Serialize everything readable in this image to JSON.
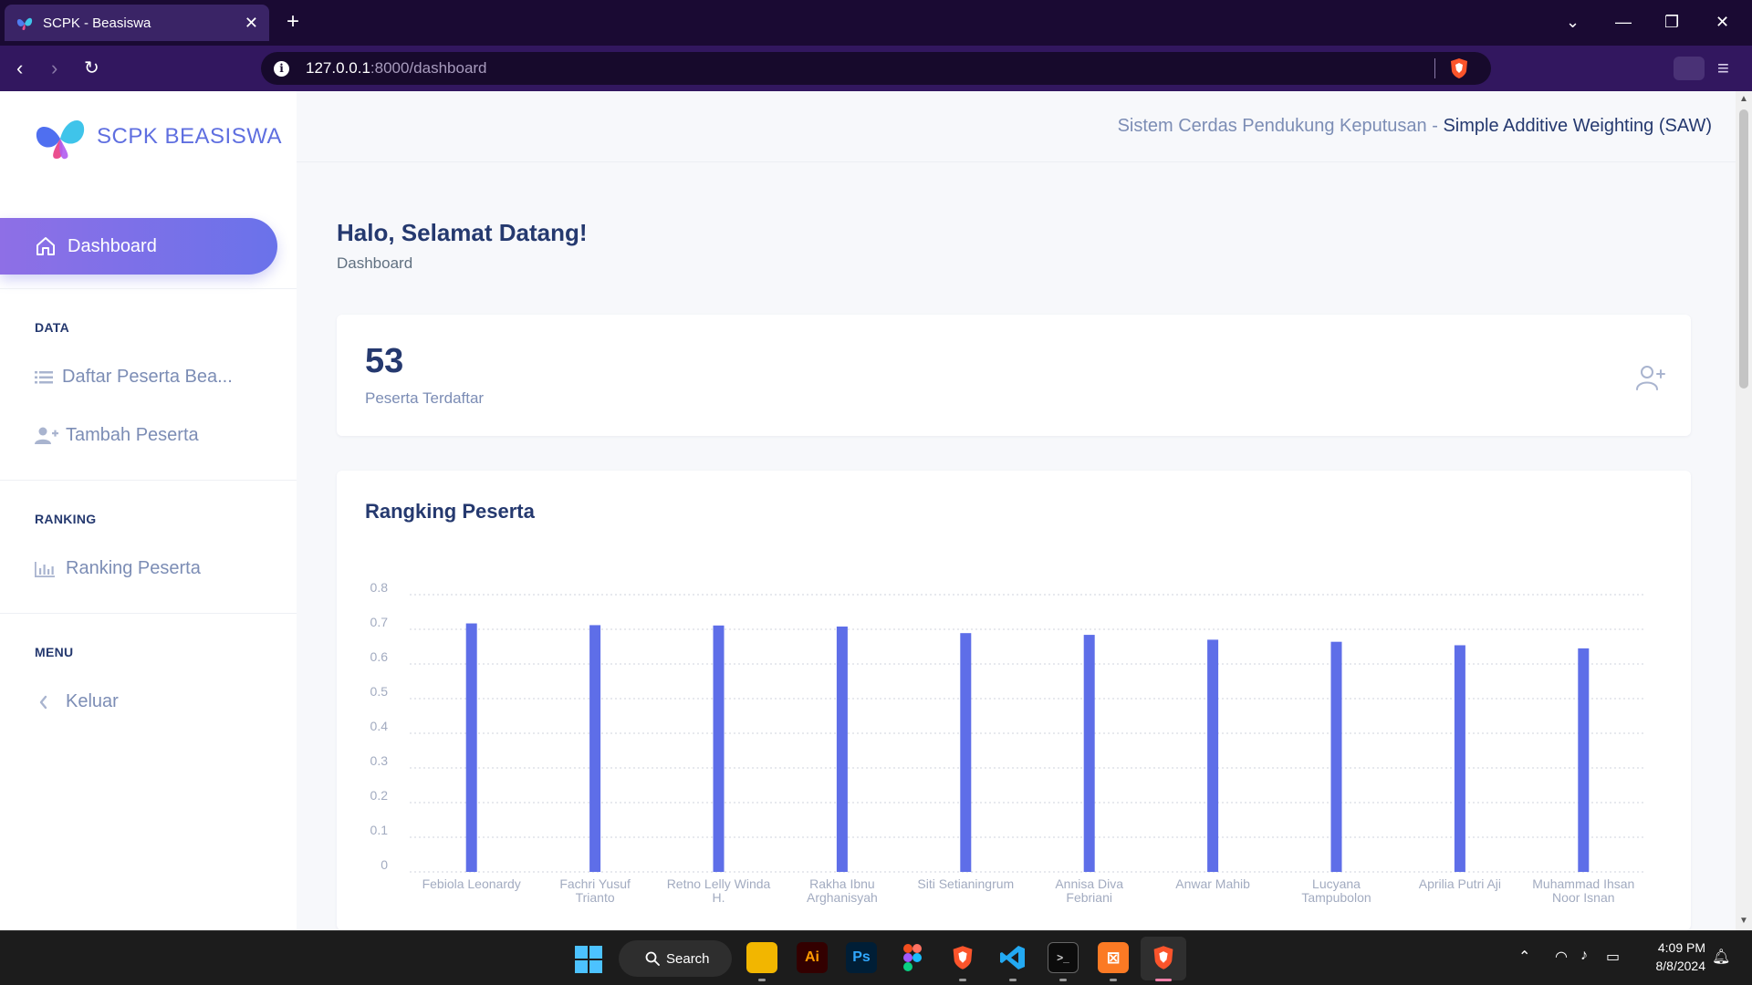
{
  "browser": {
    "tab_title": "SCPK - Beasiswa",
    "tab_close": "✕",
    "new_tab": "+",
    "url_host": "127.0.0.1",
    "url_rest": ":8000/dashboard"
  },
  "sidebar": {
    "brand": "SCPK BEASISWA",
    "active_item": "Dashboard",
    "sections": {
      "data": "DATA",
      "ranking": "RANKING",
      "menu": "MENU"
    },
    "items": {
      "daftar": "Daftar Peserta Bea...",
      "tambah": "Tambah Peserta",
      "ranking": "Ranking Peserta",
      "keluar": "Keluar"
    }
  },
  "topbar": {
    "muted": "Sistem Cerdas Pendukung Keputusan - ",
    "strong": "Simple Additive Weighting (SAW)"
  },
  "main": {
    "heading": "Halo, Selamat Datang!",
    "breadcrumb": "Dashboard",
    "stat": {
      "value": "53",
      "label": "Peserta Terdaftar"
    }
  },
  "chart_data": {
    "type": "bar",
    "title": "Rangking Peserta",
    "xlabel": "",
    "ylabel": "",
    "ylim": [
      0,
      0.8
    ],
    "yticks": [
      "0",
      "0.1",
      "0.2",
      "0.3",
      "0.4",
      "0.5",
      "0.6",
      "0.7",
      "0.8"
    ],
    "grid": true,
    "bar_color": "#5e6ee8",
    "categories": [
      [
        "Febiola Leonardy"
      ],
      [
        "Fachri Yusuf",
        "Trianto"
      ],
      [
        "Retno Lelly Winda",
        "H."
      ],
      [
        "Rakha Ibnu",
        "Arghanisyah"
      ],
      [
        "Siti Setianingrum"
      ],
      [
        "Annisa Diva",
        "Febriani"
      ],
      [
        "Anwar Mahib"
      ],
      [
        "Lucyana",
        "Tampubolon"
      ],
      [
        "Aprilia Putri Aji"
      ],
      [
        "Muhammad Ihsan",
        "Noor Isnan"
      ]
    ],
    "values": [
      0.717,
      0.712,
      0.711,
      0.708,
      0.689,
      0.684,
      0.67,
      0.664,
      0.654,
      0.645
    ]
  },
  "taskbar": {
    "search": "Search",
    "time": "4:09 PM",
    "date": "8/8/2024"
  }
}
